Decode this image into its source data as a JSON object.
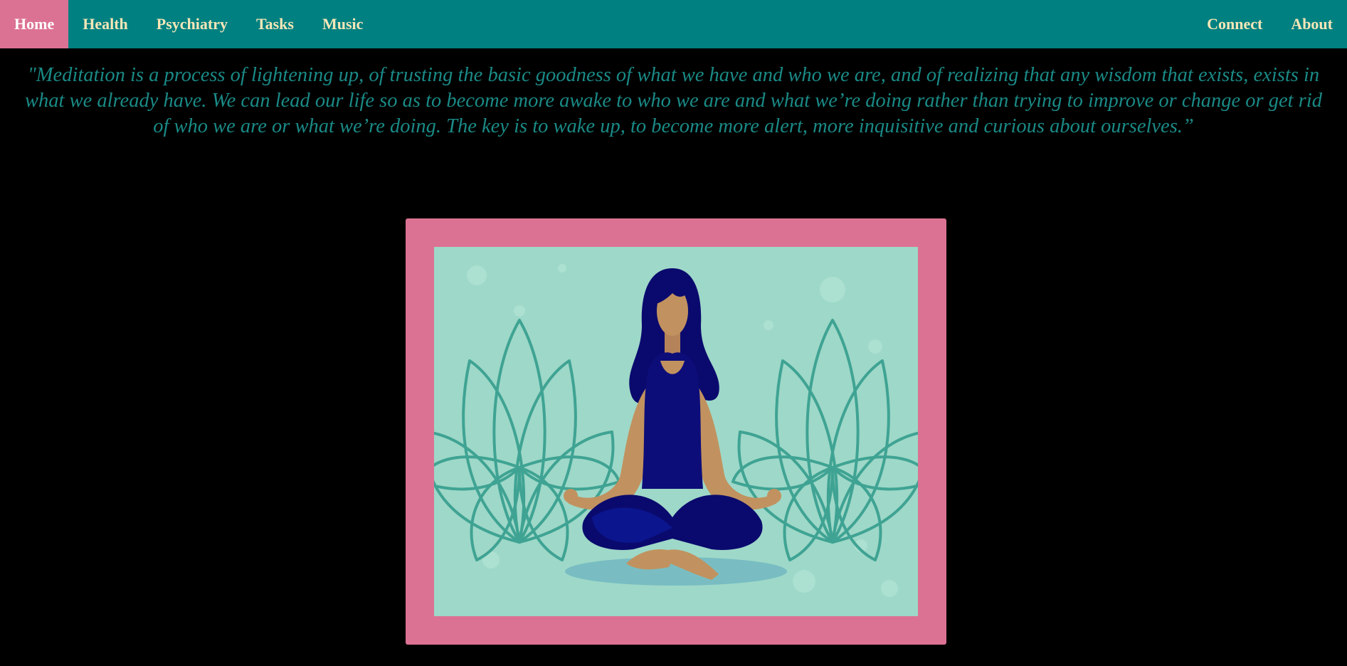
{
  "nav": {
    "left": [
      {
        "label": "Home",
        "active": true
      },
      {
        "label": "Health",
        "active": false
      },
      {
        "label": "Psychiatry",
        "active": false
      },
      {
        "label": "Tasks",
        "active": false
      },
      {
        "label": "Music",
        "active": false
      }
    ],
    "right": [
      {
        "label": "Connect"
      },
      {
        "label": "About"
      }
    ]
  },
  "quote": "\"Meditation is a process of lightening up, of trusting the basic goodness of what we have and who we are, and of realizing that any wisdom that exists, exists in what we already have. We can lead our life so as to become more awake to who we are and what we’re doing rather than trying to improve or change or get rid of who we are or what we’re doing. The key is to wake up, to become more alert, more inquisitive and curious about ourselves.”",
  "colors": {
    "navbar": "#008080",
    "active_tab": "#dc7293",
    "nav_text": "#f5e6b8",
    "quote_text": "#1a8a86",
    "frame": "#dc7293",
    "background": "#000000"
  },
  "image": {
    "subject": "woman meditating in lotus pose with lotus flowers",
    "icon": "meditation-illustration"
  }
}
